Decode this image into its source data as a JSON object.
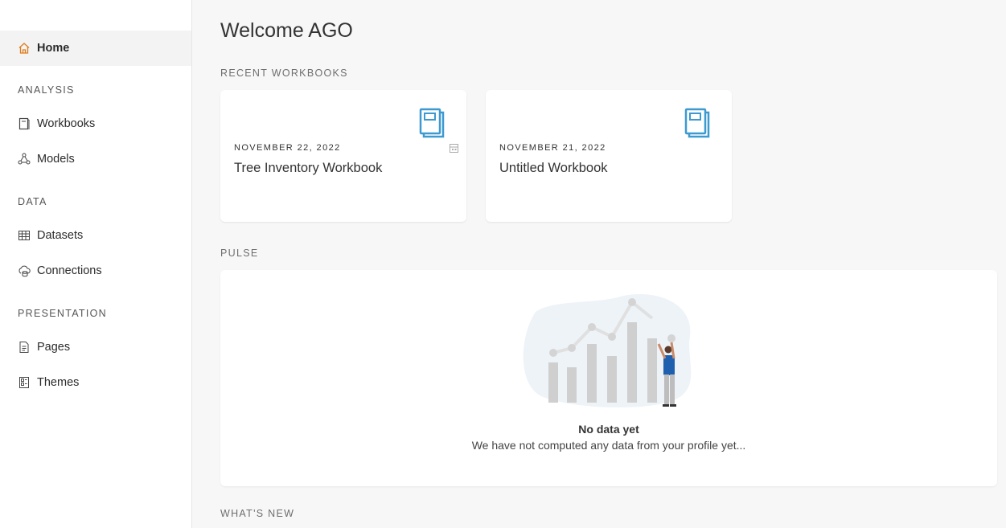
{
  "sidebar": {
    "home_label": "Home",
    "analysis_label": "ANALYSIS",
    "workbooks_label": "Workbooks",
    "models_label": "Models",
    "data_label": "DATA",
    "datasets_label": "Datasets",
    "connections_label": "Connections",
    "presentation_label": "PRESENTATION",
    "pages_label": "Pages",
    "themes_label": "Themes"
  },
  "main": {
    "title": "Welcome AGO",
    "recent_label": "RECENT WORKBOOKS",
    "workbooks": [
      {
        "date": "NOVEMBER 22, 2022",
        "title": "Tree Inventory Workbook"
      },
      {
        "date": "NOVEMBER 21, 2022",
        "title": "Untitled Workbook"
      }
    ],
    "pulse_label": "PULSE",
    "pulse_empty_title": "No data yet",
    "pulse_empty_text": "We have not computed any data from your profile yet...",
    "whats_new_label": "WHAT'S NEW"
  },
  "colors": {
    "accent_orange": "#e07b1a",
    "accent_blue": "#3d9ad1",
    "sidebar_active_bg": "#f3f3f3"
  },
  "icons": {
    "home": "home-icon",
    "workbooks": "workbook-icon",
    "models": "model-icon",
    "datasets": "dataset-icon",
    "connections": "connection-icon",
    "pages": "page-icon",
    "themes": "theme-icon",
    "card": "book-icon"
  }
}
